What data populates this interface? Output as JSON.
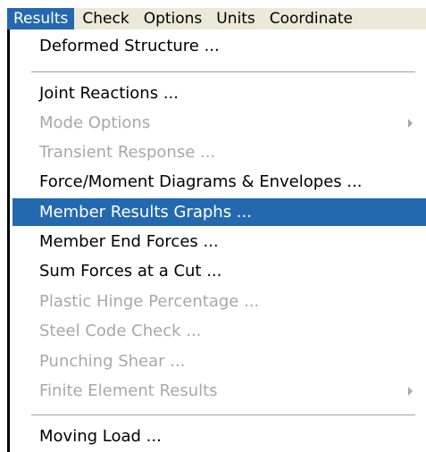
{
  "menubar": {
    "items": [
      {
        "label": "Results",
        "active": true
      },
      {
        "label": "Check"
      },
      {
        "label": "Options"
      },
      {
        "label": "Units"
      },
      {
        "label": "Coordinate"
      }
    ]
  },
  "results_menu": {
    "items": [
      {
        "label": "Deformed Structure ...",
        "enabled": true
      },
      {
        "label": "Joint Reactions ...",
        "enabled": true
      },
      {
        "label": "Mode Options",
        "enabled": false,
        "submenu": true
      },
      {
        "label": "Transient Response ...",
        "enabled": false
      },
      {
        "label": "Force/Moment Diagrams & Envelopes ...",
        "enabled": true
      },
      {
        "label": "Member Results Graphs ...",
        "enabled": true,
        "highlighted": true
      },
      {
        "label": "Member End Forces ...",
        "enabled": true
      },
      {
        "label": "Sum Forces at a Cut ...",
        "enabled": true
      },
      {
        "label": "Plastic Hinge Percentage ...",
        "enabled": false
      },
      {
        "label": "Steel Code Check ...",
        "enabled": false
      },
      {
        "label": "Punching Shear ...",
        "enabled": false
      },
      {
        "label": "Finite Element Results",
        "enabled": false,
        "submenu": true
      },
      {
        "label": "Moving Load ...",
        "enabled": true
      }
    ]
  },
  "colors": {
    "highlight": "#2468b0",
    "disabled_text": "#a8a8a8"
  }
}
